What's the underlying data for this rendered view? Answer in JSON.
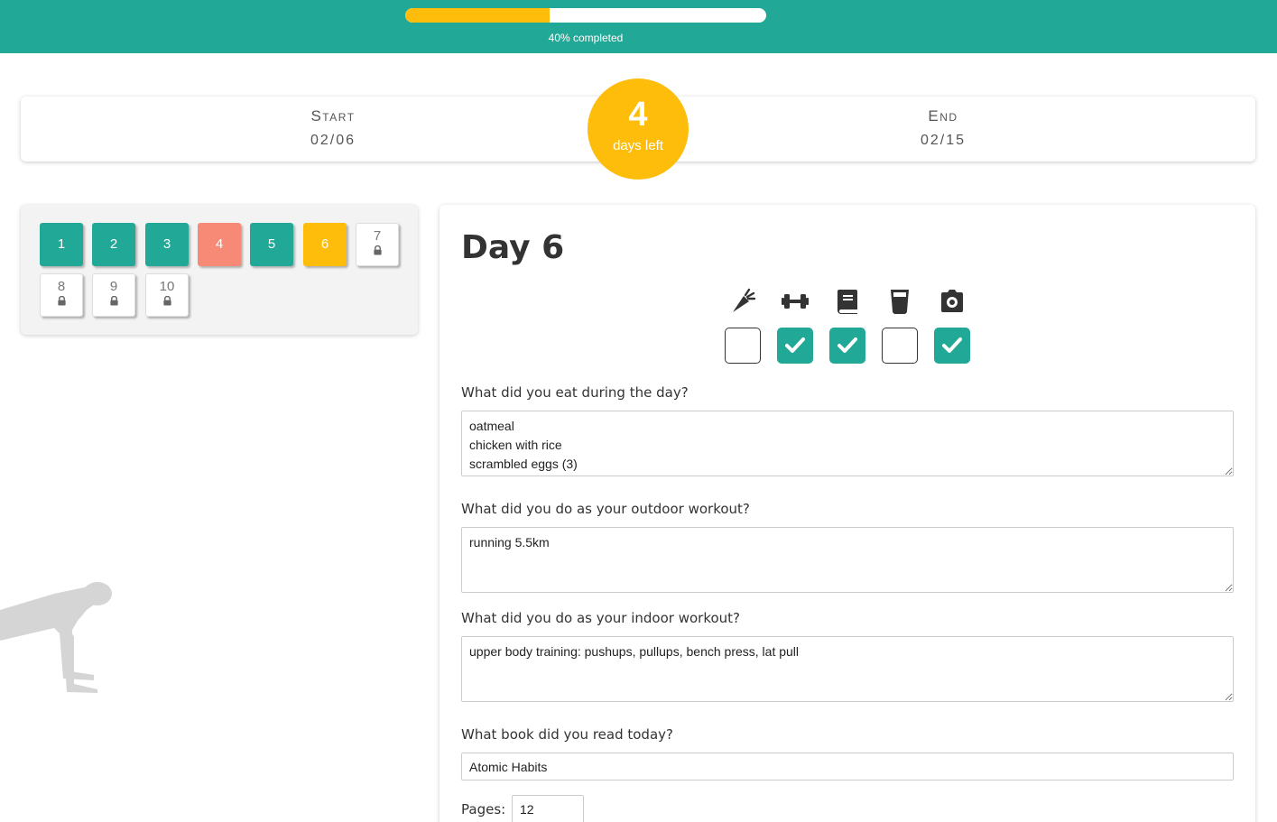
{
  "progress": {
    "percent": 40,
    "label": "40% completed"
  },
  "dates": {
    "start_label": "Start",
    "start_value": "02/06",
    "end_label": "End",
    "end_value": "02/15"
  },
  "countdown": {
    "number": "4",
    "text": "days left"
  },
  "days": [
    {
      "label": "1",
      "status": "done"
    },
    {
      "label": "2",
      "status": "done"
    },
    {
      "label": "3",
      "status": "done"
    },
    {
      "label": "4",
      "status": "missed"
    },
    {
      "label": "5",
      "status": "done"
    },
    {
      "label": "6",
      "status": "current"
    },
    {
      "label": "7",
      "status": "locked"
    },
    {
      "label": "8",
      "status": "locked"
    },
    {
      "label": "9",
      "status": "locked"
    },
    {
      "label": "10",
      "status": "locked"
    }
  ],
  "main": {
    "title": "Day 6",
    "habits": [
      {
        "icon": "carrot-icon",
        "checked": false
      },
      {
        "icon": "dumbbell-icon",
        "checked": true
      },
      {
        "icon": "book-icon",
        "checked": true
      },
      {
        "icon": "water-glass-icon",
        "checked": false
      },
      {
        "icon": "camera-icon",
        "checked": true
      }
    ],
    "q_food": {
      "label": "What did you eat during the day?",
      "value": "oatmeal\nchicken with rice\nscrambled eggs (3)"
    },
    "q_outdoor": {
      "label": "What did you do as your outdoor workout?",
      "value": "running 5.5km"
    },
    "q_indoor": {
      "label": "What did you do as your indoor workout?",
      "value": "upper body training: pushups, pullups, bench press, lat pull"
    },
    "q_book": {
      "label": "What book did you read today?",
      "value": "Atomic Habits"
    },
    "pages": {
      "label": "Pages:",
      "value": "12"
    }
  },
  "colors": {
    "teal": "#22a896",
    "yellow": "#fdbd0a",
    "salmon": "#f78a76"
  }
}
